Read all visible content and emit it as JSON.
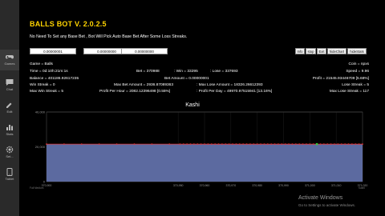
{
  "sidebar": {
    "items": [
      {
        "label": "Games",
        "icon": "gamepad-icon"
      },
      {
        "label": "Chat",
        "icon": "chat-icon"
      },
      {
        "label": "Edit",
        "icon": "pencil-icon"
      },
      {
        "label": "Stats",
        "icon": "bar-chart-icon"
      },
      {
        "label": "Set...",
        "icon": "gear-icon"
      },
      {
        "label": "Tablet",
        "icon": "tablet-icon"
      }
    ]
  },
  "header": {
    "title": "BALLS BOT V. 2.0.2.5",
    "notice": "No Need To Set any Base Bet , Bot Will Pick Auto Base Bet After Some Loss Streaks."
  },
  "inputs": [
    "0.00000001",
    "0.00000000",
    "0.00000000"
  ],
  "toolbar": {
    "buttons": [
      "Info",
      "stop",
      "Exit",
      "hideChart",
      "hideStats"
    ]
  },
  "stats": {
    "game": "Game = Balls",
    "coin": "Coin = npxs",
    "time": "Time = 0d:10h:21m:1s",
    "bet": "Bet = 370988",
    "win": ": Win = 33295",
    "lose": ": Lose = 337693",
    "speed": "Speed = 9.96",
    "balance": "Balance = 401186.92617235",
    "bet_amount": "Bet Amount = 0.00000001",
    "profit": "Profit = 21545.93446709 [5.68%]",
    "win_streak": "Win Streak = 0",
    "max_bet_amount": "Max Bet Amount = 2936.87089363",
    "max_lose_amount": ": Max Lose Amount = 18326.26612393",
    "lose_streak": "Lose Streak = 5",
    "max_win_streak": "Max Win Streak = 5",
    "profit_per_hour": "Profit Per Hour = 2082.12396498 [0.55%]",
    "profit_per_day": ": Profit Per Day = 49970.97515941 [13.16%]",
    "max_lose_streak": "Max Lose Streak = 117"
  },
  "chart_data": {
    "type": "area",
    "title": "Kashi",
    "y_ticks": [
      "40,000",
      "20,000",
      "0"
    ],
    "ylim": [
      0,
      40000
    ],
    "x_ticks": [
      "370,900",
      "370,950",
      "370,960",
      "370,970",
      "370,980",
      "370,990",
      "371,000",
      "371,010",
      "371,020"
    ],
    "x": [
      370900,
      370950,
      370960,
      370970,
      370980,
      370990,
      371000,
      371010,
      371020
    ],
    "values": [
      21545,
      21546,
      21546,
      21547,
      21547,
      21546,
      21547,
      21547,
      21546
    ],
    "fill_color": "#5c6aa0",
    "line_color": "#e03131",
    "highlight_color": "#37c837",
    "footer_left": "Full Medium",
    "footer_right": "Kashi"
  },
  "watermark": {
    "line1": "Activate Windows",
    "line2": "Go to Settings to activate Windows."
  }
}
